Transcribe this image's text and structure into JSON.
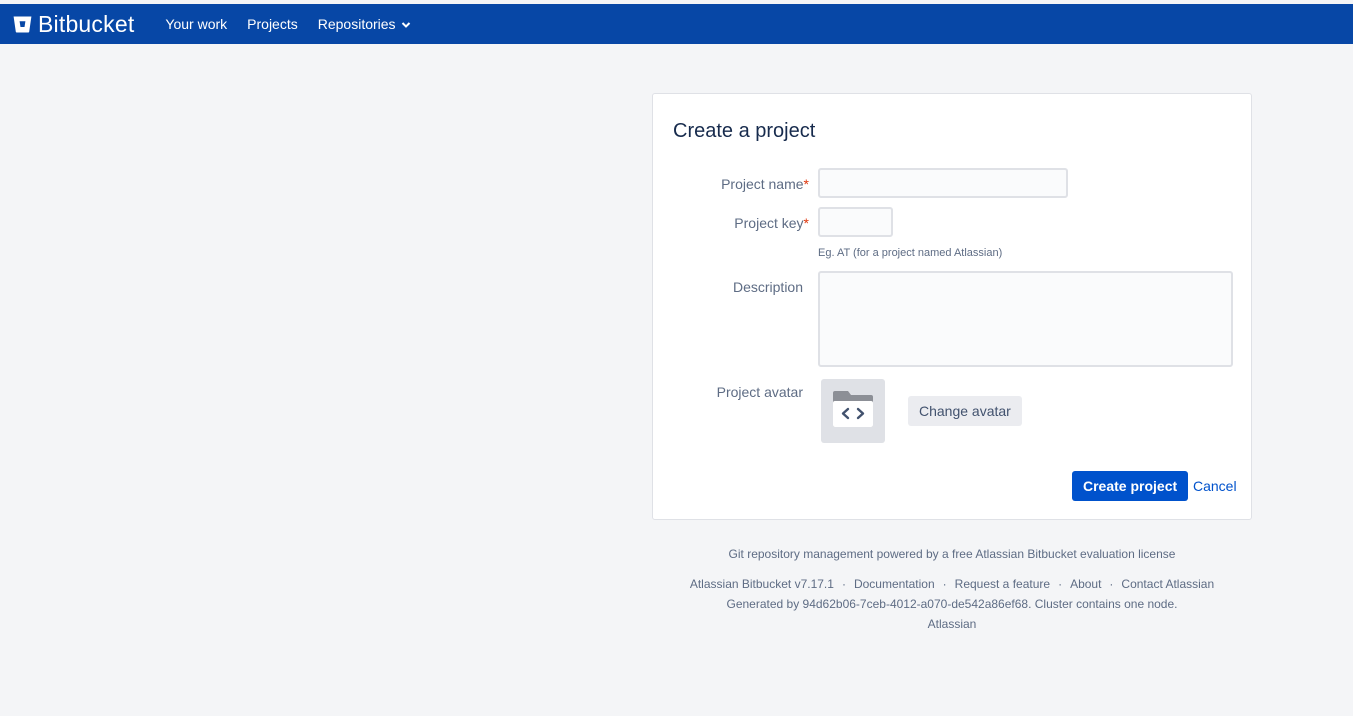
{
  "header": {
    "logo_text": "Bitbucket",
    "nav": [
      {
        "label": "Your work"
      },
      {
        "label": "Projects"
      },
      {
        "label": "Repositories"
      }
    ]
  },
  "form": {
    "title": "Create a project",
    "project_name": {
      "label": "Project name",
      "required_mark": "*",
      "value": ""
    },
    "project_key": {
      "label": "Project key",
      "required_mark": "*",
      "value": "",
      "hint": "Eg. AT (for a project named Atlassian)"
    },
    "description": {
      "label": "Description",
      "value": ""
    },
    "avatar": {
      "label": "Project avatar",
      "change_button": "Change avatar"
    },
    "create_button": "Create project",
    "cancel_link": "Cancel"
  },
  "footer": {
    "license": "Git repository management powered by a free Atlassian Bitbucket evaluation license",
    "links": [
      "Atlassian Bitbucket v7.17.1",
      "Documentation",
      "Request a feature",
      "About",
      "Contact Atlassian"
    ],
    "separator": "·",
    "generated": "Generated by 94d62b06-7ceb-4012-a070-de542a86ef68. Cluster contains one node.",
    "company": "Atlassian"
  },
  "colors": {
    "header_bg": "#0747a6",
    "primary": "#0052cc",
    "page_bg": "#f4f5f7",
    "required": "#de350b"
  }
}
